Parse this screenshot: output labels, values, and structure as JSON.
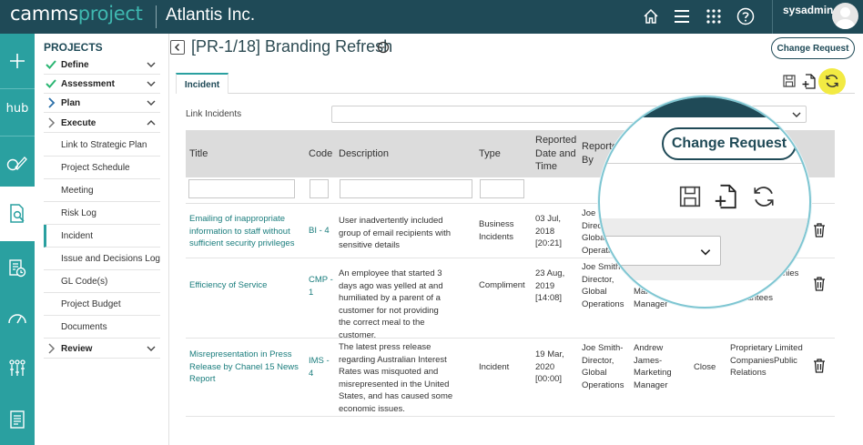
{
  "header": {
    "brand_part1": "camms",
    "brand_part2": "project",
    "organization": "Atlantis Inc.",
    "username": "sysadmin"
  },
  "rail": {
    "hub_label": "hub"
  },
  "projects_menu": {
    "title": "PROJECTS",
    "sections": [
      {
        "label": "Define",
        "state": "complete"
      },
      {
        "label": "Assessment",
        "state": "complete"
      },
      {
        "label": "Plan",
        "state": "pending"
      },
      {
        "label": "Execute",
        "state": "expanded"
      }
    ],
    "execute_items": [
      "Link to Strategic Plan",
      "Project Schedule",
      "Meeting",
      "Risk Log",
      "Incident",
      "Issue and Decisions Log",
      "GL Code(s)",
      "Project Budget",
      "Documents"
    ],
    "active_item": "Incident",
    "review_label": "Review"
  },
  "page": {
    "title": "[PR-1/18] Branding Refresh",
    "change_request_label": "Change Request",
    "tab_label": "Incident",
    "link_incidents_label": "Link Incidents"
  },
  "table": {
    "headers": {
      "title": "Title",
      "code": "Code",
      "description": "Description",
      "type": "Type",
      "reported_date": "Reported Date and Time",
      "reported_by": "Reported By"
    },
    "rows": [
      {
        "title": "Emailing of inappropriate information to staff without sufficient security privileges",
        "code": "BI - 4",
        "description": "User inadvertently included group of email recipients with sensitive details",
        "type": "Business Incidents",
        "date": "03 Jul, 2018 [20:21]",
        "reported_by": "Joe Smith-Director, Global Operations",
        "assigned_to": "",
        "status": "",
        "category": ""
      },
      {
        "title": "Efficiency of Service",
        "code": "CMP - 1",
        "description": "An employee that started 3 days ago was yelled at and humiliated by a parent of a customer for not providing the correct meal to the customer.",
        "type": "Compliment",
        "date": "23 Aug, 2019 [14:08]",
        "reported_by": "Joe Smith-Director, Global Operations",
        "assigned_to": "Marketing Manager",
        "status": "",
        "category_l1": "nies",
        "category_l2": "arantees"
      },
      {
        "title": "Misrepresentation in Press Release by Chanel 15 News Report",
        "code": "IMS - 4",
        "description": "The latest press release regarding Australian Interest Rates was misquoted and misrepresented in the United States, and has caused some economic issues.",
        "type": "Incident",
        "date": "19 Mar, 2020 [00:00]",
        "reported_by": "Joe Smith-Director, Global Operations",
        "assigned_to": "Andrew James-Marketing Manager",
        "status": "Close",
        "category": "Proprietary Limited CompaniesPublic Relations"
      }
    ]
  },
  "magnifier": {
    "change_request_label": "Change Request"
  },
  "colors": {
    "topbar": "#1f4a57",
    "accent": "#2aa0a0",
    "refresh_highlight": "#f2ea43",
    "link": "#1a7d7d"
  },
  "icons": [
    "home-icon",
    "menu-icon",
    "apps-grid-icon",
    "help-icon",
    "plus-icon",
    "edit-icon",
    "document-search-icon",
    "calendar-report-icon",
    "gauge-icon",
    "org-chart-icon",
    "report-icon",
    "back-icon",
    "chat-icon",
    "save-icon",
    "add-document-icon",
    "refresh-icon",
    "trash-icon"
  ]
}
